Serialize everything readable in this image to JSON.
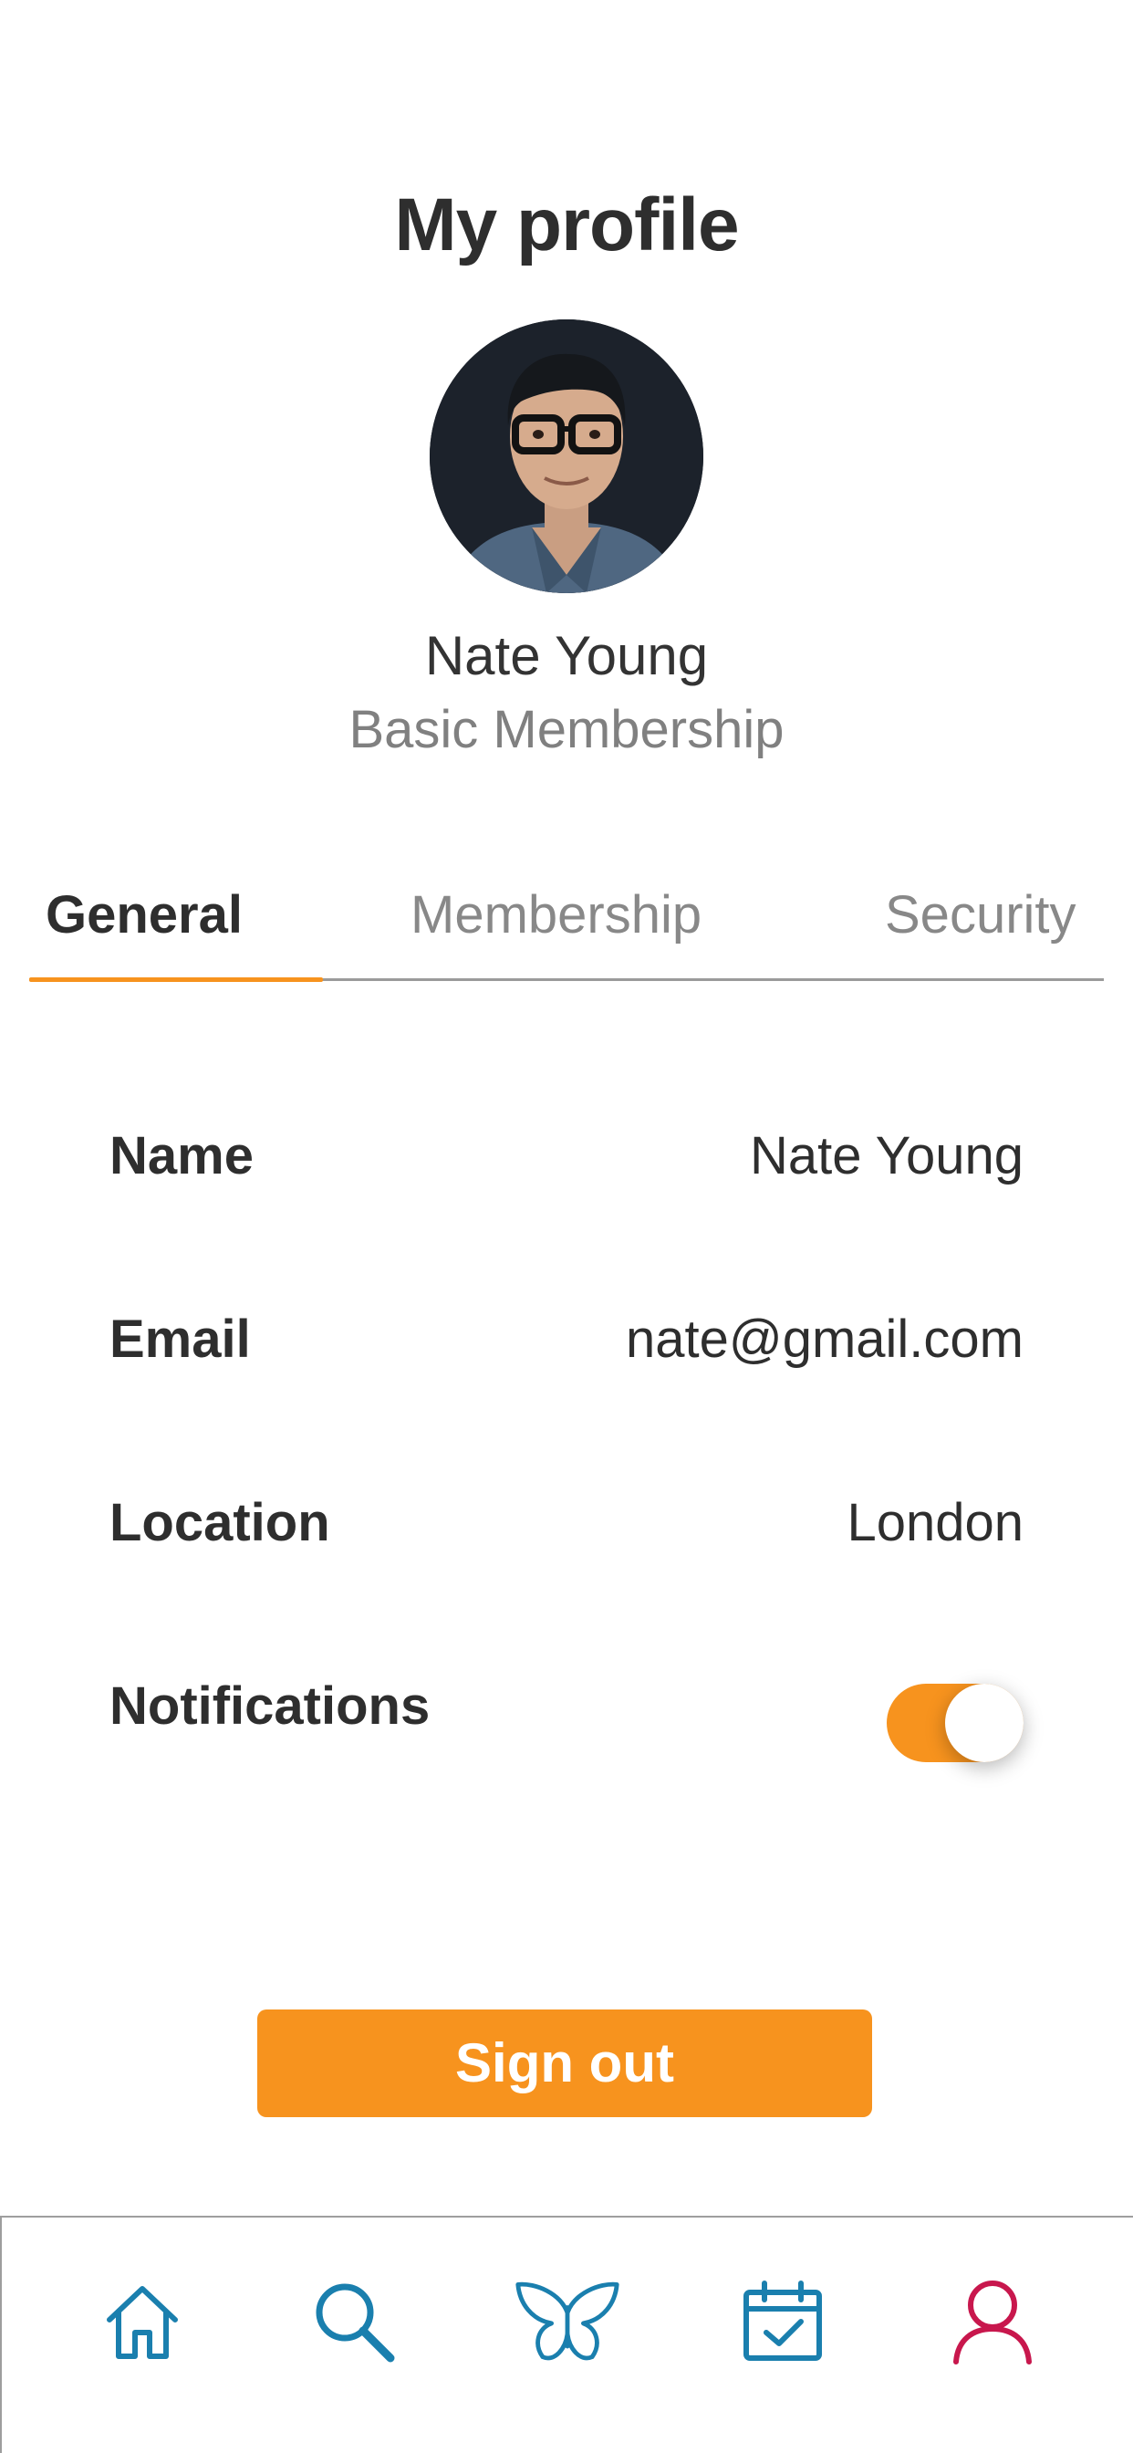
{
  "header": {
    "title": "My profile"
  },
  "profile": {
    "name": "Nate Young",
    "membership": "Basic Membership"
  },
  "tabs": [
    {
      "label": "General",
      "active": true
    },
    {
      "label": "Membership",
      "active": false
    },
    {
      "label": "Security",
      "active": false
    }
  ],
  "fields": {
    "name": {
      "label": "Name",
      "value": "Nate Young"
    },
    "email": {
      "label": "Email",
      "value": "nate@gmail.com"
    },
    "location": {
      "label": "Location",
      "value": "London"
    },
    "notifications": {
      "label": "Notifications",
      "enabled": true
    }
  },
  "actions": {
    "sign_out_label": "Sign out"
  },
  "bottom_nav": [
    {
      "icon": "home-icon",
      "active": false
    },
    {
      "icon": "search-icon",
      "active": false
    },
    {
      "icon": "butterfly-icon",
      "active": false
    },
    {
      "icon": "calendar-check-icon",
      "active": false
    },
    {
      "icon": "profile-icon",
      "active": true
    }
  ],
  "colors": {
    "accent": "#f7931e",
    "nav_icon": "#1a7fae",
    "nav_icon_active": "#c8174d",
    "text_primary": "#2e2e2e",
    "text_secondary": "#808080"
  }
}
